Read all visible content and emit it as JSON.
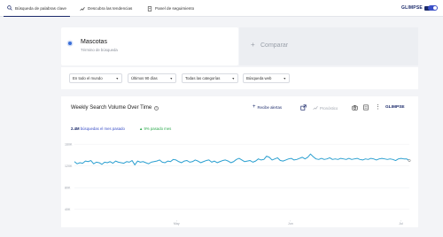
{
  "nav": {
    "tabs": [
      {
        "label": "Búsqueda de palabras clave",
        "icon": "search-icon"
      },
      {
        "label": "Descubra las tendencias",
        "icon": "trend-icon"
      },
      {
        "label": "Panel de seguimiento",
        "icon": "panel-icon"
      }
    ],
    "logo": "GLIMPSE"
  },
  "keyword": {
    "title": "Mascotas",
    "subtitle": "Término de búsqueda"
  },
  "compare": {
    "label": "Comparar",
    "plus": "+"
  },
  "filters": [
    {
      "label": "En todo el mundo"
    },
    {
      "label": "Últimos 90 días"
    },
    {
      "label": "Todas las categorías"
    },
    {
      "label": "Búsqueda web"
    }
  ],
  "chart_card": {
    "title": "Weekly Search Volume Over Time",
    "info": "i",
    "alert_label": "Recibe alertas",
    "trend_label": "Pronóstico",
    "logo": "GLIMPSE",
    "stat_volume": "2.4M",
    "stat_volume_text": "búsquedas el mes pasado",
    "stat_change": "9% pasado mes"
  },
  "colors": {
    "accent": "#1c2b6b",
    "line": "#2a9fd0",
    "positive": "#2eaa4e"
  },
  "chart_data": {
    "type": "line",
    "title": "Weekly Search Volume Over Time",
    "y_tick_labels": [
      "160K",
      "120K",
      "80K",
      "40K"
    ],
    "x_tick_labels": [
      "May",
      "Jun",
      "Jul"
    ],
    "series": [
      {
        "values": [
          128,
          124,
          126,
          125,
          129,
          128,
          130,
          124,
          127,
          126,
          123,
          127,
          126,
          128,
          125,
          129,
          127,
          126,
          125,
          128,
          127,
          130,
          122,
          129,
          127,
          128,
          126,
          124,
          127,
          128,
          129,
          131,
          127,
          126,
          129,
          128,
          132,
          131,
          128,
          126,
          129,
          130,
          127,
          128,
          131,
          129,
          126,
          128,
          130,
          131,
          127,
          129,
          126,
          128,
          130,
          131,
          129,
          126,
          128,
          132,
          134,
          131,
          128,
          129,
          130,
          127,
          129,
          133,
          131,
          132,
          138,
          136,
          131,
          133,
          135,
          130,
          129,
          131,
          133,
          134,
          131,
          132,
          134,
          136,
          133,
          136,
          142,
          137,
          133,
          132,
          134,
          132,
          133,
          135,
          132,
          133,
          132,
          134,
          133,
          132,
          134,
          132,
          133,
          134,
          132,
          131,
          133,
          132,
          134,
          133,
          131,
          133,
          134,
          133,
          132,
          133,
          132,
          130,
          133,
          134,
          133,
          133,
          130
        ]
      }
    ],
    "ylim": [
      20,
      170
    ],
    "grid": true
  }
}
